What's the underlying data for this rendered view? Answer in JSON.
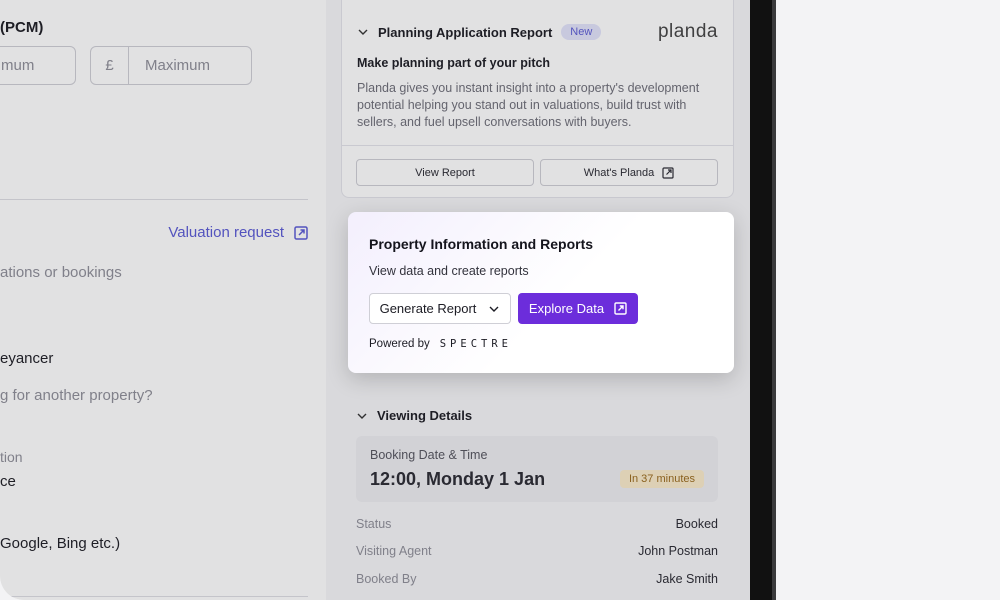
{
  "left": {
    "rent_label": "(PCM)",
    "min_placeholder": "mum",
    "currency": "£",
    "max_placeholder": "Maximum",
    "valuation_link": "Valuation request",
    "line_bookings": "ations or bookings",
    "line_conveyancer": "eyancer",
    "line_another_property": "g for another property?",
    "line_tion": "tion",
    "line_ce": "ce",
    "line_google": "Google, Bing etc.)"
  },
  "planning": {
    "title": "Planning Application Report",
    "badge": "New",
    "logo": "planda",
    "subtitle": "Make planning part of your pitch",
    "body": "Planda gives you instant insight into a property's development potential helping you stand out in valuations, build trust with sellers, and fuel upsell conversations with buyers.",
    "view_report": "View Report",
    "whats_planda": "What's Planda"
  },
  "pir": {
    "title": "Property Information and Reports",
    "subtitle": "View data and create reports",
    "generate_label": "Generate Report",
    "explore_label": "Explore Data",
    "powered_by": "Powered by",
    "brand": "SPECTRE"
  },
  "viewing": {
    "title": "Viewing Details",
    "booking_label": "Booking Date & Time",
    "booking_value": "12:00, Monday 1 Jan",
    "booking_pill": "In 37 minutes",
    "rows": [
      {
        "key": "Status",
        "value": "Booked"
      },
      {
        "key": "Visiting Agent",
        "value": "John Postman"
      },
      {
        "key": "Booked By",
        "value": "Jake Smith"
      }
    ]
  }
}
